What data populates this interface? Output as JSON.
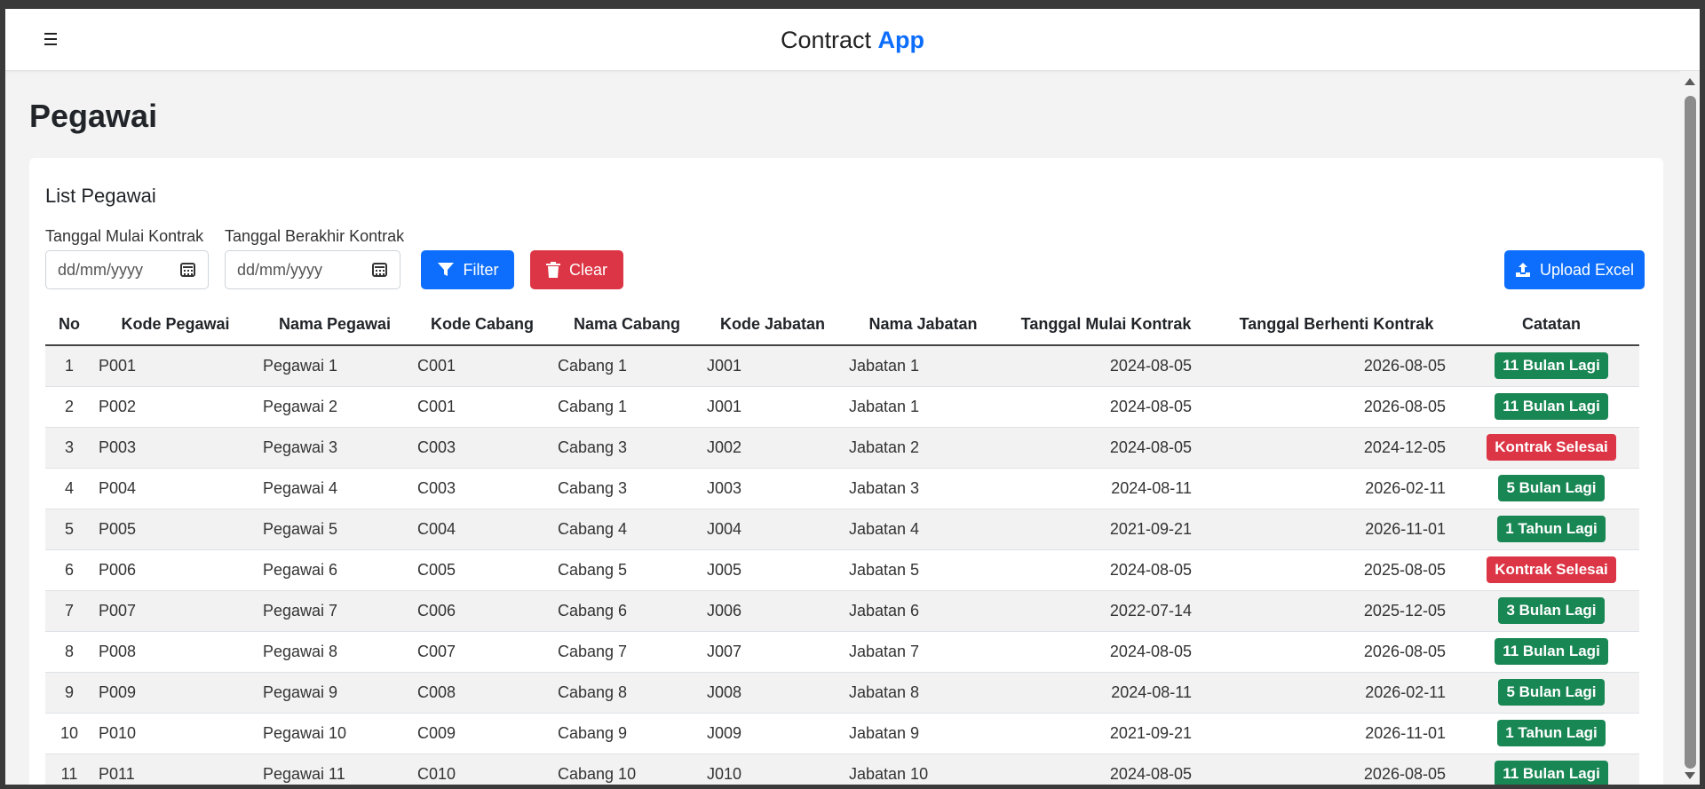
{
  "app": {
    "brand_main": "Contract",
    "brand_accent": "App"
  },
  "page": {
    "title": "Pegawai"
  },
  "card": {
    "title": "List Pegawai",
    "filters": {
      "start_label": "Tanggal Mulai Kontrak",
      "start_placeholder": "dd/mm/yyyy",
      "end_label": "Tanggal Berakhir Kontrak",
      "end_placeholder": "dd/mm/yyyy",
      "filter_button": "Filter",
      "clear_button": "Clear",
      "upload_button": "Upload Excel"
    }
  },
  "table": {
    "columns": [
      "No",
      "Kode Pegawai",
      "Nama Pegawai",
      "Kode Cabang",
      "Nama Cabang",
      "Kode Jabatan",
      "Nama Jabatan",
      "Tanggal Mulai Kontrak",
      "Tanggal Berhenti Kontrak",
      "Catatan"
    ],
    "rows": [
      {
        "no": "1",
        "kode_pegawai": "P001",
        "nama_pegawai": "Pegawai 1",
        "kode_cabang": "C001",
        "nama_cabang": "Cabang 1",
        "kode_jabatan": "J001",
        "nama_jabatan": "Jabatan 1",
        "mulai": "2024-08-05",
        "berhenti": "2026-08-05",
        "catatan": "11 Bulan Lagi",
        "status": "green"
      },
      {
        "no": "2",
        "kode_pegawai": "P002",
        "nama_pegawai": "Pegawai 2",
        "kode_cabang": "C001",
        "nama_cabang": "Cabang 1",
        "kode_jabatan": "J001",
        "nama_jabatan": "Jabatan 1",
        "mulai": "2024-08-05",
        "berhenti": "2026-08-05",
        "catatan": "11 Bulan Lagi",
        "status": "green"
      },
      {
        "no": "3",
        "kode_pegawai": "P003",
        "nama_pegawai": "Pegawai 3",
        "kode_cabang": "C003",
        "nama_cabang": "Cabang 3",
        "kode_jabatan": "J002",
        "nama_jabatan": "Jabatan 2",
        "mulai": "2024-08-05",
        "berhenti": "2024-12-05",
        "catatan": "Kontrak Selesai",
        "status": "red"
      },
      {
        "no": "4",
        "kode_pegawai": "P004",
        "nama_pegawai": "Pegawai 4",
        "kode_cabang": "C003",
        "nama_cabang": "Cabang 3",
        "kode_jabatan": "J003",
        "nama_jabatan": "Jabatan 3",
        "mulai": "2024-08-11",
        "berhenti": "2026-02-11",
        "catatan": "5 Bulan Lagi",
        "status": "green"
      },
      {
        "no": "5",
        "kode_pegawai": "P005",
        "nama_pegawai": "Pegawai 5",
        "kode_cabang": "C004",
        "nama_cabang": "Cabang 4",
        "kode_jabatan": "J004",
        "nama_jabatan": "Jabatan 4",
        "mulai": "2021-09-21",
        "berhenti": "2026-11-01",
        "catatan": "1 Tahun Lagi",
        "status": "green"
      },
      {
        "no": "6",
        "kode_pegawai": "P006",
        "nama_pegawai": "Pegawai 6",
        "kode_cabang": "C005",
        "nama_cabang": "Cabang 5",
        "kode_jabatan": "J005",
        "nama_jabatan": "Jabatan 5",
        "mulai": "2024-08-05",
        "berhenti": "2025-08-05",
        "catatan": "Kontrak Selesai",
        "status": "red"
      },
      {
        "no": "7",
        "kode_pegawai": "P007",
        "nama_pegawai": "Pegawai 7",
        "kode_cabang": "C006",
        "nama_cabang": "Cabang 6",
        "kode_jabatan": "J006",
        "nama_jabatan": "Jabatan 6",
        "mulai": "2022-07-14",
        "berhenti": "2025-12-05",
        "catatan": "3 Bulan Lagi",
        "status": "green"
      },
      {
        "no": "8",
        "kode_pegawai": "P008",
        "nama_pegawai": "Pegawai 8",
        "kode_cabang": "C007",
        "nama_cabang": "Cabang 7",
        "kode_jabatan": "J007",
        "nama_jabatan": "Jabatan 7",
        "mulai": "2024-08-05",
        "berhenti": "2026-08-05",
        "catatan": "11 Bulan Lagi",
        "status": "green"
      },
      {
        "no": "9",
        "kode_pegawai": "P009",
        "nama_pegawai": "Pegawai 9",
        "kode_cabang": "C008",
        "nama_cabang": "Cabang 8",
        "kode_jabatan": "J008",
        "nama_jabatan": "Jabatan 8",
        "mulai": "2024-08-11",
        "berhenti": "2026-02-11",
        "catatan": "5 Bulan Lagi",
        "status": "green"
      },
      {
        "no": "10",
        "kode_pegawai": "P010",
        "nama_pegawai": "Pegawai 10",
        "kode_cabang": "C009",
        "nama_cabang": "Cabang 9",
        "kode_jabatan": "J009",
        "nama_jabatan": "Jabatan 9",
        "mulai": "2021-09-21",
        "berhenti": "2026-11-01",
        "catatan": "1 Tahun Lagi",
        "status": "green"
      },
      {
        "no": "11",
        "kode_pegawai": "P011",
        "nama_pegawai": "Pegawai 11",
        "kode_cabang": "C010",
        "nama_cabang": "Cabang 10",
        "kode_jabatan": "J010",
        "nama_jabatan": "Jabatan 10",
        "mulai": "2024-08-05",
        "berhenti": "2026-08-05",
        "catatan": "11 Bulan Lagi",
        "status": "green"
      }
    ]
  },
  "colors": {
    "primary": "#0d6efd",
    "danger": "#dc3545",
    "success": "#198754"
  },
  "icons": {
    "menu": "hamburger-icon",
    "calendar": "calendar-icon",
    "filter": "filter-icon",
    "clear": "trash-icon",
    "upload": "upload-icon"
  }
}
